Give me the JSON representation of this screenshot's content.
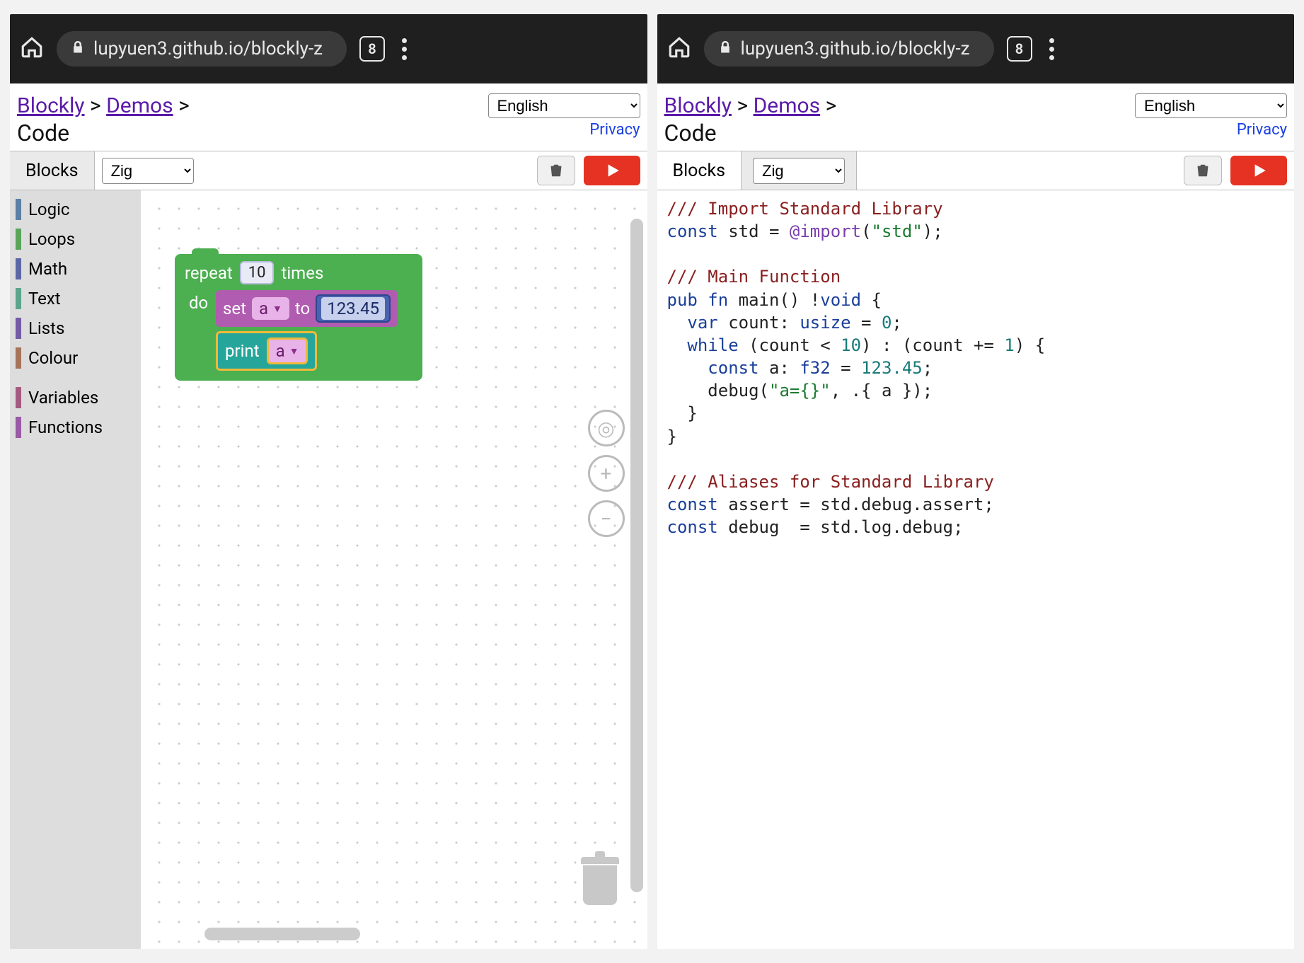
{
  "chrome": {
    "url": "lupyuen3.github.io/blockly-z",
    "tab_count": "8"
  },
  "header": {
    "crumb_blockly": "Blockly",
    "crumb_demos": "Demos",
    "crumb_sep": ">",
    "crumb_current": "Code",
    "lang": "English",
    "privacy": "Privacy"
  },
  "toolbar": {
    "tab_blocks": "Blocks",
    "codelang": "Zig"
  },
  "toolbox": [
    {
      "label": "Logic",
      "color": "#5b80a5"
    },
    {
      "label": "Loops",
      "color": "#5ba55b"
    },
    {
      "label": "Math",
      "color": "#5b67a5"
    },
    {
      "label": "Text",
      "color": "#5ba58c"
    },
    {
      "label": "Lists",
      "color": "#745ba5"
    },
    {
      "label": "Colour",
      "color": "#a5745b"
    },
    {
      "label": "Variables",
      "color": "#a55b80"
    },
    {
      "label": "Functions",
      "color": "#995ba5"
    }
  ],
  "blocks": {
    "repeat": "repeat",
    "times": "times",
    "count": "10",
    "do": "do",
    "set": "set",
    "var": "a",
    "to": "to",
    "value": "123.45",
    "print": "print"
  },
  "code": {
    "l1": "/// Import Standard Library",
    "l2a": "const",
    "l2b": " std = ",
    "l2c": "@import",
    "l2d": "(",
    "l2e": "\"std\"",
    "l2f": ");",
    "l3": "/// Main Function",
    "l4a": "pub fn",
    "l4b": " main() !",
    "l4c": "void",
    "l4d": " {",
    "l5a": "  var",
    "l5b": " count: ",
    "l5c": "usize",
    "l5d": " = ",
    "l5e": "0",
    "l5f": ";",
    "l6a": "  while",
    "l6b": " (count < ",
    "l6c": "10",
    "l6d": ") : (count += ",
    "l6e": "1",
    "l6f": ") {",
    "l7a": "    const",
    "l7b": " a: ",
    "l7c": "f32",
    "l7d": " = ",
    "l7e": "123.45",
    "l7f": ";",
    "l8a": "    debug(",
    "l8b": "\"a={}\"",
    "l8c": ", .{ a });",
    "l9": "  }",
    "l10": "}",
    "l11": "/// Aliases for Standard Library",
    "l12a": "const",
    "l12b": " assert = std.debug.assert;",
    "l13a": "const",
    "l13b": " debug  = std.log.debug;"
  }
}
